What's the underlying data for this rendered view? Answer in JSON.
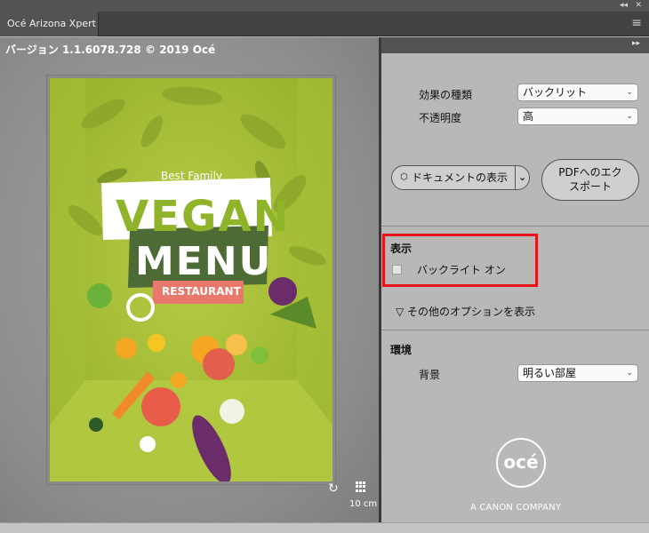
{
  "app": {
    "tab_title": "Océ Arizona Xpert",
    "version_text": "バージョン 1.1.6078.728 © 2019 Océ",
    "window_controls": [
      "◂◂",
      "✕"
    ],
    "menu_icon": "hamburger-icon"
  },
  "preview": {
    "scale_label": "10 cm",
    "rotate_icon": "rotate-icon",
    "grid_icon": "grid-icon",
    "poster": {
      "line1": "Best Family",
      "line2": "Restaurant",
      "headline1": "VEGAN",
      "headline2": "MENU",
      "badge": "RESTAURANT"
    }
  },
  "panel": {
    "collapse_icon": "▸▸",
    "effect": {
      "label": "効果の種類",
      "value": "バックリット"
    },
    "opacity": {
      "label": "不透明度",
      "value": "高"
    },
    "doc_button": "ドキュメントの表示",
    "pdf_button_line1": "PDFへのエク",
    "pdf_button_line2": "スポート",
    "display": {
      "title": "表示",
      "backlight_label": "バックライト オン",
      "backlight_checked": false
    },
    "more_options": "▽ その他のオプションを表示",
    "environment": {
      "title": "環境",
      "background_label": "背景",
      "background_value": "明るい部屋"
    },
    "logo_text": "océ",
    "company": "A CANON COMPANY"
  },
  "colors": {
    "highlight": "#e8121b",
    "poster_green": "#a3bd2f",
    "headline_green": "#8fb42a",
    "banner_dark": "#4d6b35",
    "badge_red": "#e8786c"
  }
}
